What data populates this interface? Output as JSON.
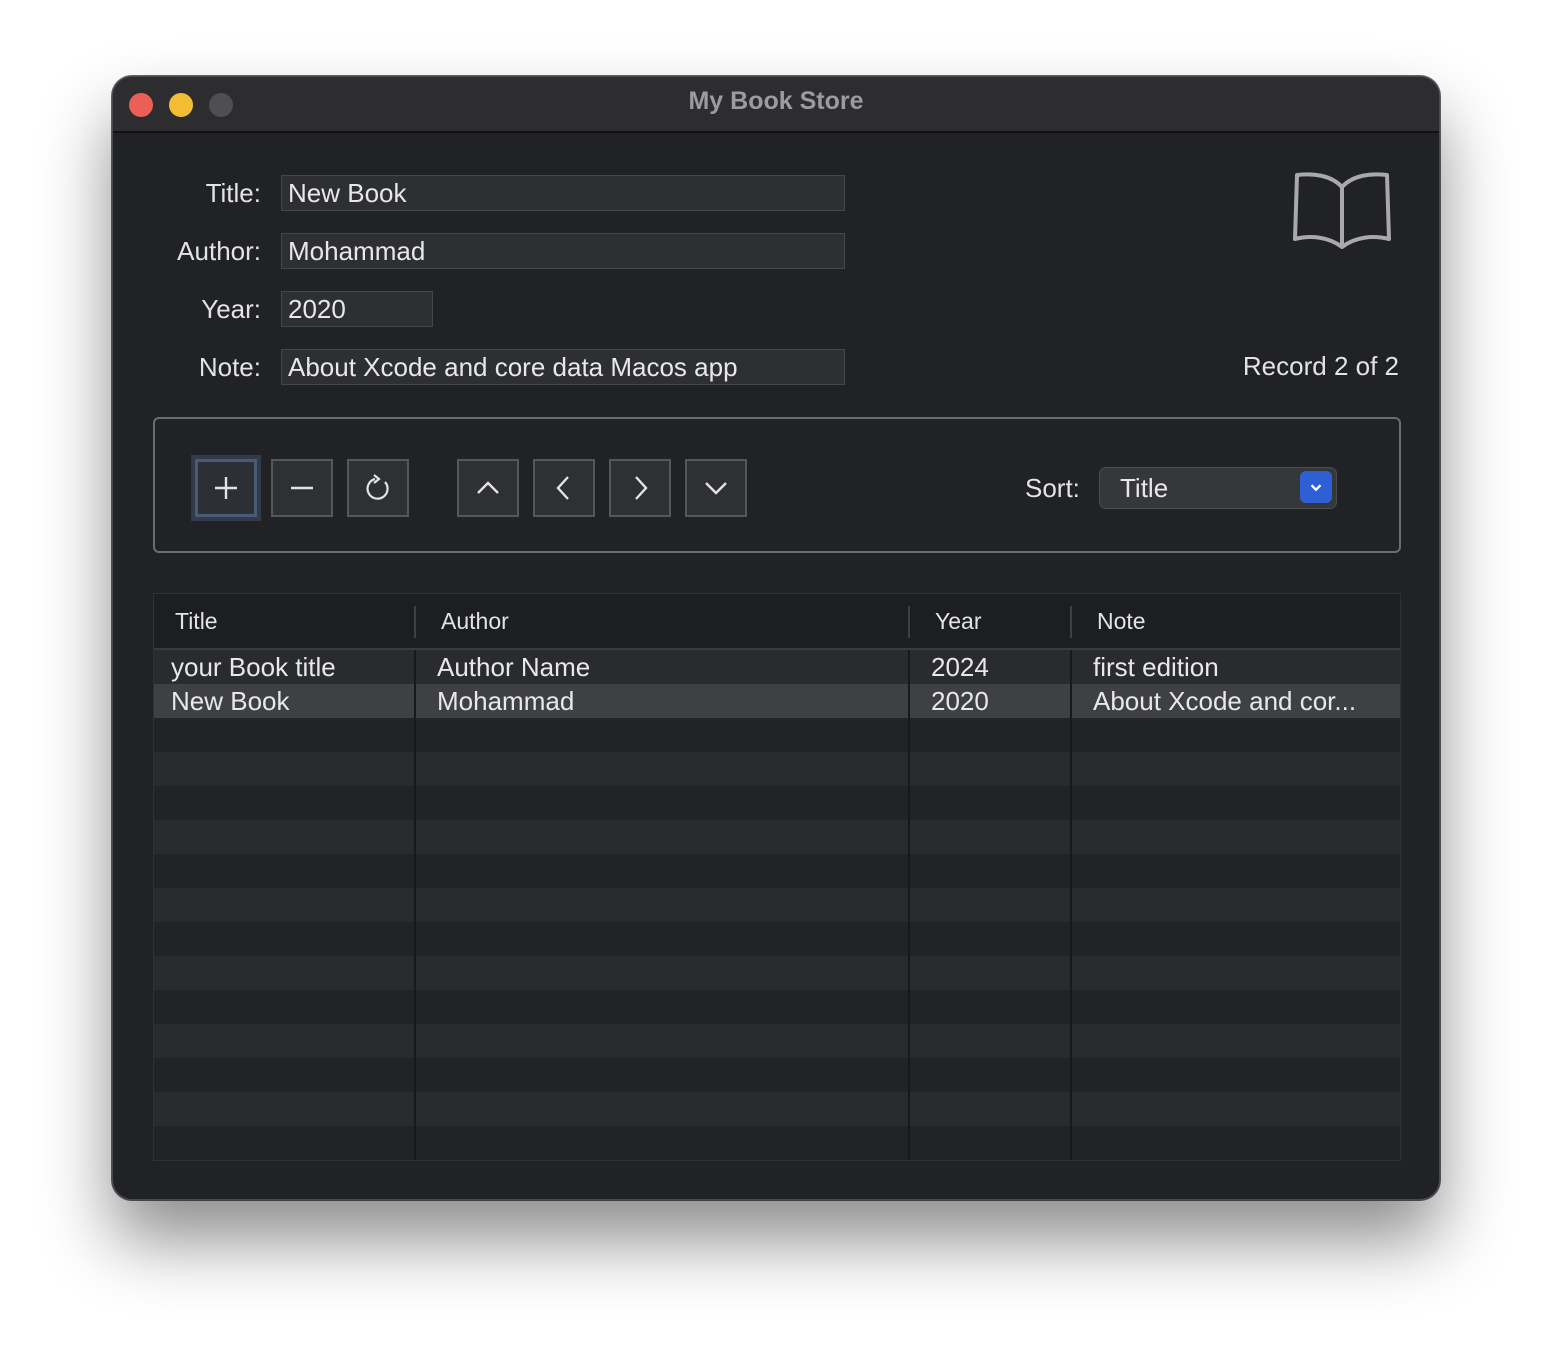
{
  "window": {
    "title": "My Book Store"
  },
  "form": {
    "title_label": "Title:",
    "title_value": "New Book",
    "author_label": "Author:",
    "author_value": "Mohammad",
    "year_label": "Year:",
    "year_value": "2020",
    "note_label": "Note:",
    "note_value": "About Xcode and core data Macos app"
  },
  "status": {
    "record": "Record 2 of 2"
  },
  "toolbar": {
    "buttons": [
      {
        "name": "add-button",
        "icon": "plus-icon"
      },
      {
        "name": "delete-button",
        "icon": "minus-icon"
      },
      {
        "name": "refresh-button",
        "icon": "refresh-icon"
      },
      {
        "name": "first-record-button",
        "icon": "chevron-up-icon"
      },
      {
        "name": "previous-record-button",
        "icon": "chevron-left-icon"
      },
      {
        "name": "next-record-button",
        "icon": "chevron-right-icon"
      },
      {
        "name": "last-record-button",
        "icon": "chevron-down-icon"
      }
    ],
    "sort_label": "Sort:",
    "sort_value": "Title"
  },
  "table": {
    "columns": [
      "Title",
      "Author",
      "Year",
      "Note"
    ],
    "rows": [
      [
        "your Book title",
        "Author Name",
        "2024",
        "first edition"
      ],
      [
        "New Book",
        "Mohammad",
        "2020",
        "About Xcode and cor..."
      ]
    ],
    "selected_row": 1
  },
  "colors": {
    "window_bg": "#212226",
    "accent_blue": "#2f5fd4",
    "close": "#ec5f57",
    "minimize": "#f3bd33"
  }
}
